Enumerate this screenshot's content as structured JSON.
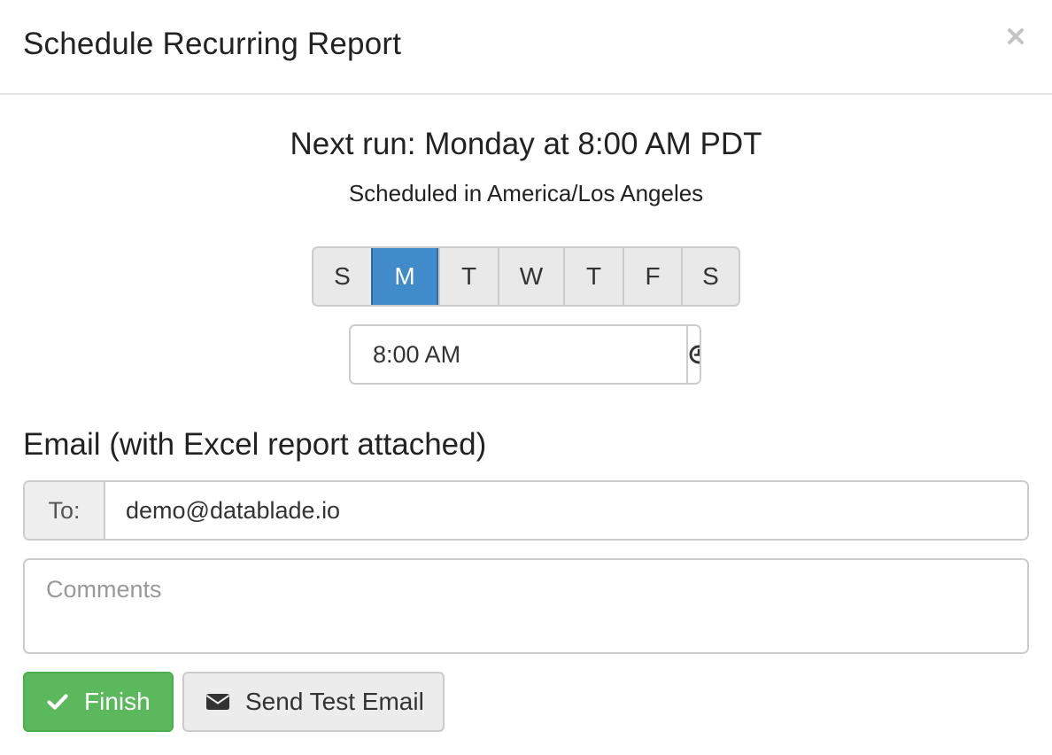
{
  "modal": {
    "title": "Schedule Recurring Report",
    "close_icon": "close-icon"
  },
  "schedule": {
    "next_run": "Next run: Monday at 8:00 AM PDT",
    "timezone": "Scheduled in America/Los Angeles",
    "days": [
      {
        "label": "S",
        "active": false
      },
      {
        "label": "M",
        "active": true
      },
      {
        "label": "T",
        "active": false
      },
      {
        "label": "W",
        "active": false
      },
      {
        "label": "T",
        "active": false
      },
      {
        "label": "F",
        "active": false
      },
      {
        "label": "S",
        "active": false
      }
    ],
    "time_value": "8:00 AM",
    "time_icon": "clock-icon"
  },
  "email": {
    "heading": "Email (with Excel report attached)",
    "to_label": "To:",
    "to_value": "demo@datablade.io",
    "comments_placeholder": "Comments",
    "comments_value": ""
  },
  "actions": {
    "finish_label": "Finish",
    "finish_icon": "check-icon",
    "test_label": "Send Test Email",
    "test_icon": "envelope-icon"
  },
  "colors": {
    "accent": "#428bca",
    "success": "#5cb85c"
  }
}
